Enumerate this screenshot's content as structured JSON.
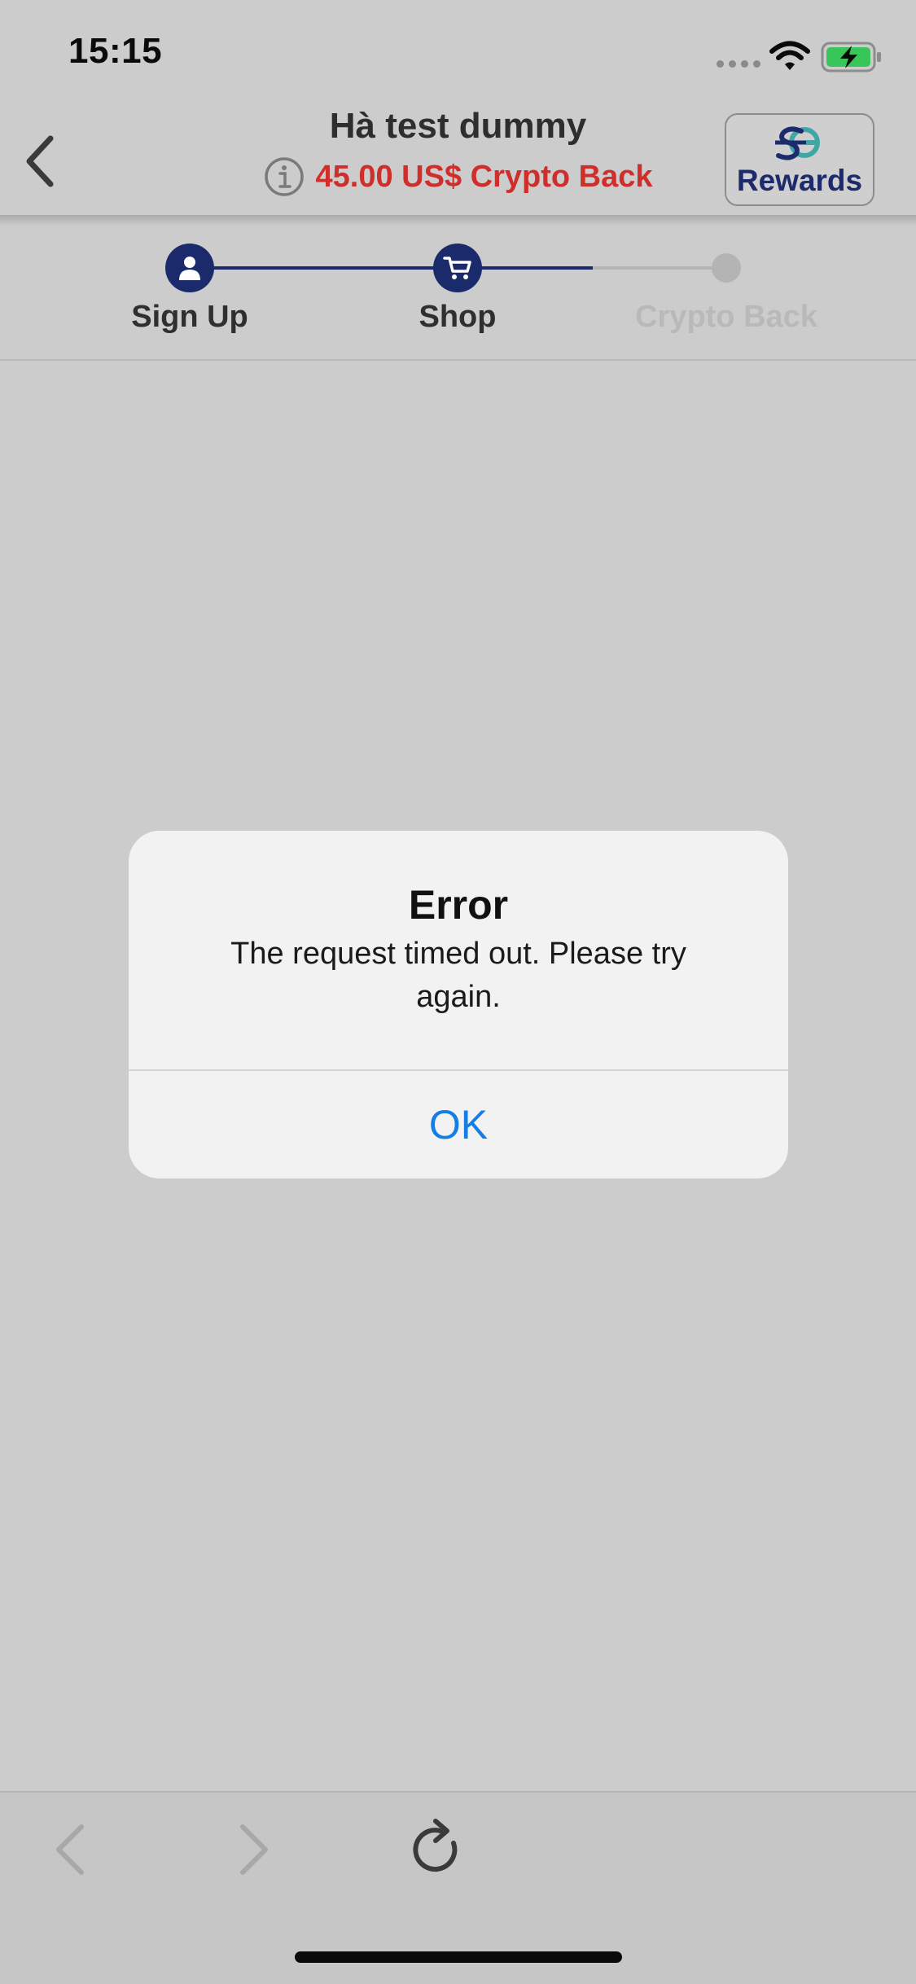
{
  "status_bar": {
    "time": "15:15",
    "icons": [
      "signal-dots-icon",
      "wifi-icon",
      "battery-charging-icon"
    ]
  },
  "header": {
    "back_icon": "chevron-left-icon",
    "title": "Hà test dummy",
    "info_icon": "info-circle-icon",
    "subtitle": "45.00 US$ Crypto Back",
    "rewards_button": {
      "logo_icon": "sg-logo-icon",
      "label": "Rewards"
    },
    "colors": {
      "subtitle": "#cf2e2a",
      "brand_navy": "#1b2a6a"
    }
  },
  "stepper": {
    "steps": [
      {
        "label": "Sign Up",
        "icon": "person-icon",
        "state": "done"
      },
      {
        "label": "Shop",
        "icon": "cart-icon",
        "state": "current"
      },
      {
        "label": "Crypto Back",
        "icon": "dot-icon",
        "state": "pending"
      }
    ]
  },
  "alert": {
    "title": "Error",
    "message": "The request timed out. Please try again.",
    "ok_label": "OK",
    "ok_color": "#147ee6"
  },
  "toolbar": {
    "back_icon": "chevron-left-icon",
    "forward_icon": "chevron-right-icon",
    "reload_icon": "reload-icon"
  }
}
